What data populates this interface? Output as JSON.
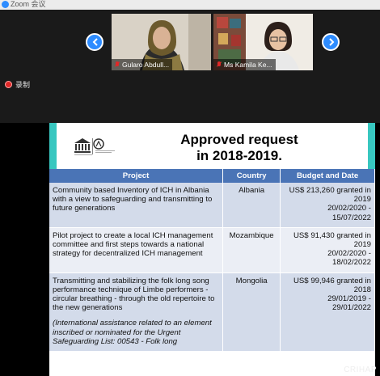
{
  "window": {
    "title": "Zoom 会议"
  },
  "participants": [
    {
      "name": "Gularo Abdull..."
    },
    {
      "name": "Ms Kamila Ke..."
    }
  ],
  "recording": {
    "label": "录制"
  },
  "slide": {
    "title_line1": "Approved request",
    "title_line2": "in 2018-2019.",
    "headers": [
      "Project",
      "Country",
      "Budget and Date"
    ],
    "rows": [
      {
        "project": "Community based Inventory of ICH in Albania with a view to safeguarding and transmitting to future generations",
        "country": "Albania",
        "budget": "US$ 213,260 granted in 2019",
        "date_from": "20/02/2020 -",
        "date_to": "15/07/2022"
      },
      {
        "project": "Pilot project to create a local ICH management committee and first steps towards a national strategy for decentralized ICH management",
        "country": "Mozambique",
        "budget": "US$ 91,430 granted in 2019",
        "date_from": "20/02/2020 -",
        "date_to": "18/02/2022"
      },
      {
        "project": "Transmitting and stabilizing the folk long song performance technique of Limbe performers - circular breathing - through the old repertoire to the new generations",
        "note": "(International assistance related to an element inscribed or nominated for the Urgent Safeguarding List: 00543 - Folk long",
        "country": "Mongolia",
        "budget": "US$ 99,946 granted in 2018",
        "date_from": "29/01/2019 -",
        "date_to": "29/01/2022"
      }
    ]
  },
  "watermark": "CRIHAP",
  "colors": {
    "accent": "#2d8cff",
    "table_header": "#4a74b6",
    "teal": "#38c7c0"
  }
}
